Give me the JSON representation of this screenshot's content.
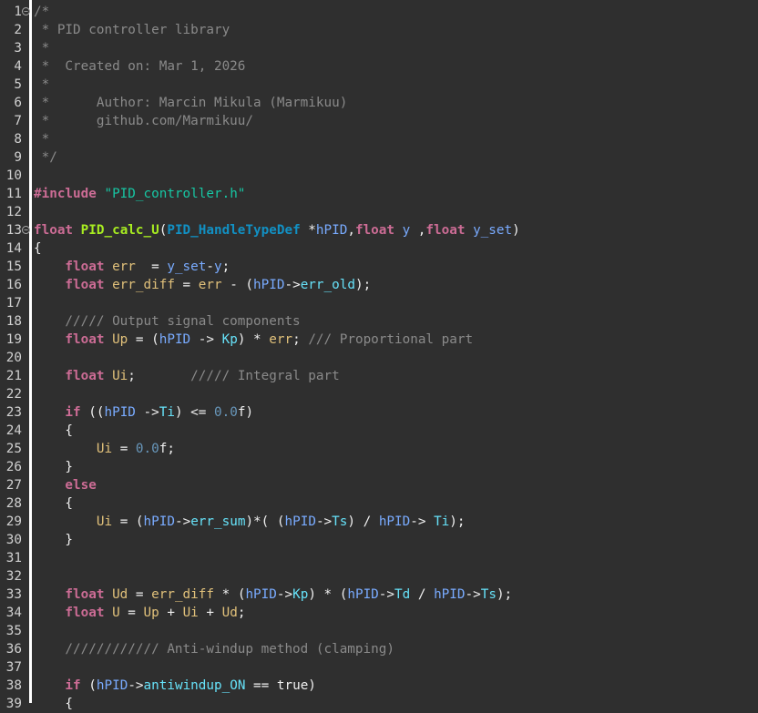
{
  "editor": {
    "lines": [
      {
        "n": "1",
        "fold": true,
        "tokens": [
          {
            "t": "/*",
            "c": "comment"
          }
        ]
      },
      {
        "n": "2",
        "tokens": [
          {
            "t": " * PID controller library",
            "c": "comment"
          }
        ]
      },
      {
        "n": "3",
        "tokens": [
          {
            "t": " *",
            "c": "comment"
          }
        ]
      },
      {
        "n": "4",
        "tokens": [
          {
            "t": " *  Created on: Mar 1, 2026",
            "c": "comment"
          }
        ]
      },
      {
        "n": "5",
        "tokens": [
          {
            "t": " *",
            "c": "comment"
          }
        ]
      },
      {
        "n": "6",
        "tokens": [
          {
            "t": " *      Author: Marcin Mikula (Marmikuu)",
            "c": "comment"
          }
        ]
      },
      {
        "n": "7",
        "tokens": [
          {
            "t": " *      github.com/Marmikuu/",
            "c": "comment"
          }
        ]
      },
      {
        "n": "8",
        "tokens": [
          {
            "t": " *",
            "c": "comment"
          }
        ]
      },
      {
        "n": "9",
        "tokens": [
          {
            "t": " */",
            "c": "comment"
          }
        ]
      },
      {
        "n": "10",
        "tokens": []
      },
      {
        "n": "11",
        "tokens": [
          {
            "t": "#include ",
            "c": "pp"
          },
          {
            "t": "\"PID_controller.h\"",
            "c": "str"
          }
        ]
      },
      {
        "n": "12",
        "tokens": []
      },
      {
        "n": "13",
        "fold": true,
        "tokens": [
          {
            "t": "float ",
            "c": "kw"
          },
          {
            "t": "PID_calc_U",
            "c": "fn"
          },
          {
            "t": "(",
            "c": "plain"
          },
          {
            "t": "PID_HandleTypeDef",
            "c": "type"
          },
          {
            "t": " *",
            "c": "plain"
          },
          {
            "t": "hPID",
            "c": "param"
          },
          {
            "t": ",",
            "c": "plain"
          },
          {
            "t": "float ",
            "c": "kw"
          },
          {
            "t": "y",
            "c": "param"
          },
          {
            "t": " ,",
            "c": "plain"
          },
          {
            "t": "float ",
            "c": "kw"
          },
          {
            "t": "y_set",
            "c": "param"
          },
          {
            "t": ")",
            "c": "plain"
          }
        ]
      },
      {
        "n": "14",
        "tokens": [
          {
            "t": "{",
            "c": "plain"
          }
        ]
      },
      {
        "n": "15",
        "tokens": [
          {
            "t": "    float ",
            "c": "kw"
          },
          {
            "t": "err",
            "c": "var"
          },
          {
            "t": "  = ",
            "c": "plain"
          },
          {
            "t": "y_set",
            "c": "param"
          },
          {
            "t": "-",
            "c": "plain"
          },
          {
            "t": "y",
            "c": "param"
          },
          {
            "t": ";",
            "c": "plain"
          }
        ]
      },
      {
        "n": "16",
        "tokens": [
          {
            "t": "    float ",
            "c": "kw"
          },
          {
            "t": "err_diff",
            "c": "var"
          },
          {
            "t": " = ",
            "c": "plain"
          },
          {
            "t": "err",
            "c": "var"
          },
          {
            "t": " - (",
            "c": "plain"
          },
          {
            "t": "hPID",
            "c": "param"
          },
          {
            "t": "->",
            "c": "plain"
          },
          {
            "t": "err_old",
            "c": "fld"
          },
          {
            "t": ");",
            "c": "plain"
          }
        ]
      },
      {
        "n": "17",
        "tokens": []
      },
      {
        "n": "18",
        "tokens": [
          {
            "t": "    ///// Output signal components",
            "c": "comment"
          }
        ]
      },
      {
        "n": "19",
        "tokens": [
          {
            "t": "    float ",
            "c": "kw"
          },
          {
            "t": "Up",
            "c": "var"
          },
          {
            "t": " = (",
            "c": "plain"
          },
          {
            "t": "hPID",
            "c": "param"
          },
          {
            "t": " -> ",
            "c": "plain"
          },
          {
            "t": "Kp",
            "c": "fld"
          },
          {
            "t": ") * ",
            "c": "plain"
          },
          {
            "t": "err",
            "c": "var"
          },
          {
            "t": "; ",
            "c": "plain"
          },
          {
            "t": "/// Proportional part",
            "c": "comment"
          }
        ]
      },
      {
        "n": "20",
        "tokens": []
      },
      {
        "n": "21",
        "tokens": [
          {
            "t": "    float ",
            "c": "kw"
          },
          {
            "t": "Ui",
            "c": "var"
          },
          {
            "t": ";       ",
            "c": "plain"
          },
          {
            "t": "///// Integral part",
            "c": "comment"
          }
        ]
      },
      {
        "n": "22",
        "tokens": []
      },
      {
        "n": "23",
        "tokens": [
          {
            "t": "    if ",
            "c": "kw"
          },
          {
            "t": "((",
            "c": "plain"
          },
          {
            "t": "hPID",
            "c": "param"
          },
          {
            "t": " ->",
            "c": "plain"
          },
          {
            "t": "Ti",
            "c": "fld"
          },
          {
            "t": ") <= ",
            "c": "plain"
          },
          {
            "t": "0.0",
            "c": "num"
          },
          {
            "t": "f)",
            "c": "plain"
          }
        ]
      },
      {
        "n": "24",
        "tokens": [
          {
            "t": "    {",
            "c": "plain"
          }
        ]
      },
      {
        "n": "25",
        "tokens": [
          {
            "t": "        ",
            "c": "plain"
          },
          {
            "t": "Ui",
            "c": "var"
          },
          {
            "t": " = ",
            "c": "plain"
          },
          {
            "t": "0.0",
            "c": "num"
          },
          {
            "t": "f;",
            "c": "plain"
          }
        ]
      },
      {
        "n": "26",
        "tokens": [
          {
            "t": "    }",
            "c": "plain"
          }
        ]
      },
      {
        "n": "27",
        "tokens": [
          {
            "t": "    else",
            "c": "kw"
          }
        ]
      },
      {
        "n": "28",
        "tokens": [
          {
            "t": "    {",
            "c": "plain"
          }
        ]
      },
      {
        "n": "29",
        "tokens": [
          {
            "t": "        ",
            "c": "plain"
          },
          {
            "t": "Ui",
            "c": "var"
          },
          {
            "t": " = (",
            "c": "plain"
          },
          {
            "t": "hPID",
            "c": "param"
          },
          {
            "t": "->",
            "c": "plain"
          },
          {
            "t": "err_sum",
            "c": "fld"
          },
          {
            "t": ")*( (",
            "c": "plain"
          },
          {
            "t": "hPID",
            "c": "param"
          },
          {
            "t": "->",
            "c": "plain"
          },
          {
            "t": "Ts",
            "c": "fld"
          },
          {
            "t": ") / ",
            "c": "plain"
          },
          {
            "t": "hPID",
            "c": "param"
          },
          {
            "t": "-> ",
            "c": "plain"
          },
          {
            "t": "Ti",
            "c": "fld"
          },
          {
            "t": ");",
            "c": "plain"
          }
        ]
      },
      {
        "n": "30",
        "tokens": [
          {
            "t": "    }",
            "c": "plain"
          }
        ]
      },
      {
        "n": "31",
        "tokens": []
      },
      {
        "n": "32",
        "tokens": []
      },
      {
        "n": "33",
        "tokens": [
          {
            "t": "    float ",
            "c": "kw"
          },
          {
            "t": "Ud",
            "c": "var"
          },
          {
            "t": " = ",
            "c": "plain"
          },
          {
            "t": "err_diff",
            "c": "var"
          },
          {
            "t": " * (",
            "c": "plain"
          },
          {
            "t": "hPID",
            "c": "param"
          },
          {
            "t": "->",
            "c": "plain"
          },
          {
            "t": "Kp",
            "c": "fld"
          },
          {
            "t": ") * (",
            "c": "plain"
          },
          {
            "t": "hPID",
            "c": "param"
          },
          {
            "t": "->",
            "c": "plain"
          },
          {
            "t": "Td",
            "c": "fld"
          },
          {
            "t": " / ",
            "c": "plain"
          },
          {
            "t": "hPID",
            "c": "param"
          },
          {
            "t": "->",
            "c": "plain"
          },
          {
            "t": "Ts",
            "c": "fld"
          },
          {
            "t": ");",
            "c": "plain"
          }
        ]
      },
      {
        "n": "34",
        "tokens": [
          {
            "t": "    float ",
            "c": "kw"
          },
          {
            "t": "U",
            "c": "var"
          },
          {
            "t": " = ",
            "c": "plain"
          },
          {
            "t": "Up",
            "c": "var"
          },
          {
            "t": " + ",
            "c": "plain"
          },
          {
            "t": "Ui",
            "c": "var"
          },
          {
            "t": " + ",
            "c": "plain"
          },
          {
            "t": "Ud",
            "c": "var"
          },
          {
            "t": ";",
            "c": "plain"
          }
        ]
      },
      {
        "n": "35",
        "tokens": []
      },
      {
        "n": "36",
        "tokens": [
          {
            "t": "    //////////// Anti-windup method (clamping)",
            "c": "comment"
          }
        ]
      },
      {
        "n": "37",
        "tokens": []
      },
      {
        "n": "38",
        "tokens": [
          {
            "t": "    if ",
            "c": "kw"
          },
          {
            "t": "(",
            "c": "plain"
          },
          {
            "t": "hPID",
            "c": "param"
          },
          {
            "t": "->",
            "c": "plain"
          },
          {
            "t": "antiwindup_ON",
            "c": "fld"
          },
          {
            "t": " == true)",
            "c": "plain"
          }
        ]
      },
      {
        "n": "39",
        "tokens": [
          {
            "t": "    {",
            "c": "plain"
          }
        ]
      }
    ]
  }
}
